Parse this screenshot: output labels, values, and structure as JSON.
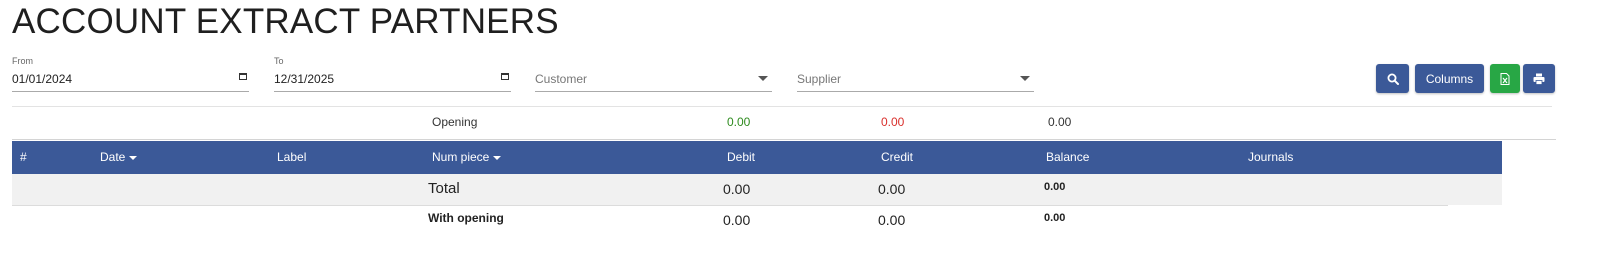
{
  "page": {
    "title": "ACCOUNT EXTRACT PARTNERS"
  },
  "filters": {
    "from_label": "From",
    "from_value": "01/01/2024",
    "to_label": "To",
    "to_value": "12/31/2025",
    "customer_placeholder": "Customer",
    "supplier_placeholder": "Supplier"
  },
  "toolbar": {
    "search_icon": "search-icon",
    "columns_label": "Columns",
    "excel_icon": "excel-icon",
    "print_icon": "print-icon"
  },
  "colors": {
    "primary": "#3b5998",
    "success": "#28a745",
    "debit": "#2e8b1e",
    "credit": "#d9302c"
  },
  "opening": {
    "label": "Opening",
    "debit": "0.00",
    "credit": "0.00",
    "balance": "0.00"
  },
  "table": {
    "headers": [
      "#",
      "Date",
      "Label",
      "Num piece",
      "Debit",
      "Credit",
      "Balance",
      "Journals"
    ],
    "total": {
      "label": "Total",
      "debit": "0.00",
      "credit": "0.00",
      "balance": "0.00"
    },
    "with_opening": {
      "label": "With opening",
      "debit": "0.00",
      "credit": "0.00",
      "balance": "0.00"
    }
  }
}
